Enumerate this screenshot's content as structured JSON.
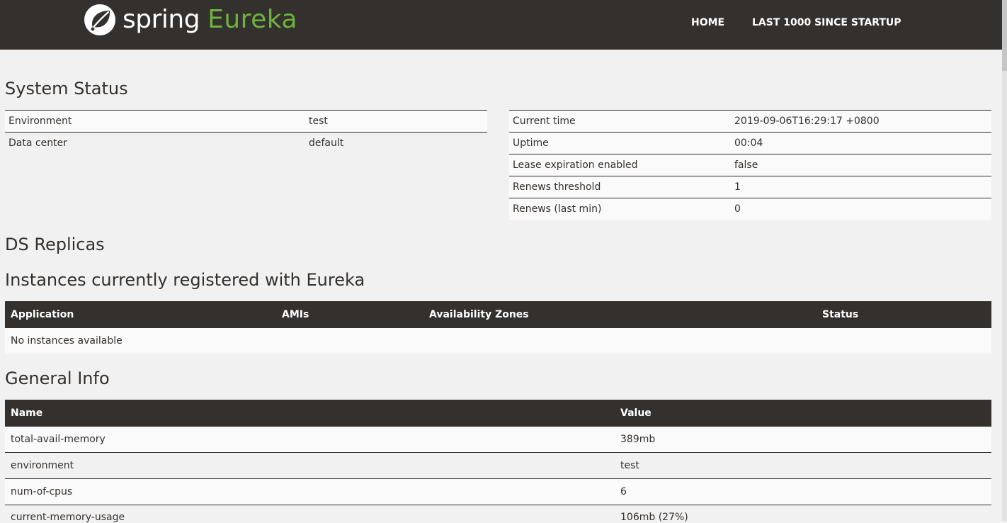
{
  "brand": {
    "spring": "spring",
    "eureka": "Eureka"
  },
  "nav": {
    "home": "HOME",
    "last1000": "LAST 1000 SINCE STARTUP"
  },
  "system_status": {
    "title": "System Status",
    "left": [
      {
        "label": "Environment",
        "value": "test"
      },
      {
        "label": "Data center",
        "value": "default"
      }
    ],
    "right": [
      {
        "label": "Current time",
        "value": "2019-09-06T16:29:17 +0800"
      },
      {
        "label": "Uptime",
        "value": "00:04"
      },
      {
        "label": "Lease expiration enabled",
        "value": "false"
      },
      {
        "label": "Renews threshold",
        "value": "1"
      },
      {
        "label": "Renews (last min)",
        "value": "0"
      }
    ]
  },
  "ds_replicas": {
    "title": "DS Replicas"
  },
  "instances": {
    "title": "Instances currently registered with Eureka",
    "columns": [
      "Application",
      "AMIs",
      "Availability Zones",
      "Status"
    ],
    "empty_message": "No instances available"
  },
  "general_info": {
    "title": "General Info",
    "columns": [
      "Name",
      "Value"
    ],
    "rows": [
      {
        "name": "total-avail-memory",
        "value": "389mb"
      },
      {
        "name": "environment",
        "value": "test"
      },
      {
        "name": "num-of-cpus",
        "value": "6"
      },
      {
        "name": "current-memory-usage",
        "value": "106mb (27%)"
      }
    ]
  },
  "colors": {
    "dark": "#34302d",
    "accent": "#6db33f",
    "background": "#f1f1f1"
  },
  "icons": {
    "logo": "spring-leaf-icon"
  }
}
